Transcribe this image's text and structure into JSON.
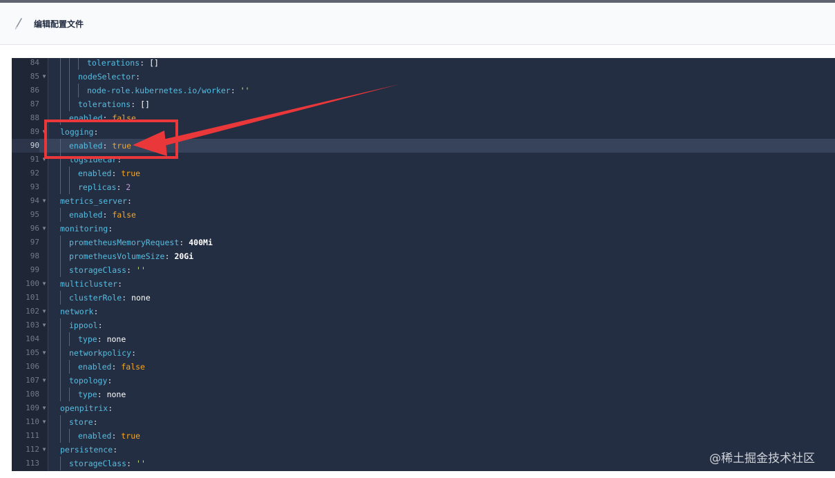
{
  "header": {
    "title": "编辑配置文件",
    "icon": "pencil-icon"
  },
  "colors": {
    "editor_background": "#242e42",
    "key": "#55bde2",
    "boolean": "#f5a623",
    "number": "#c397d8",
    "string": "#c8e17a",
    "highlight_box": "#e9373a"
  },
  "editor": {
    "active_line": 90,
    "lines": [
      {
        "num": 84,
        "fold": false,
        "indent": 3,
        "key": "tolerations",
        "value": "[]",
        "vtype": "plain"
      },
      {
        "num": 85,
        "fold": true,
        "indent": 2,
        "key": "nodeSelector",
        "value": "",
        "vtype": ""
      },
      {
        "num": 86,
        "fold": false,
        "indent": 3,
        "key": "node-role.kubernetes.io/worker",
        "value": "''",
        "vtype": "string"
      },
      {
        "num": 87,
        "fold": false,
        "indent": 2,
        "key": "tolerations",
        "value": "[]",
        "vtype": "plain"
      },
      {
        "num": 88,
        "fold": false,
        "indent": 1,
        "key": "enabled",
        "value": "false",
        "vtype": "bool"
      },
      {
        "num": 89,
        "fold": true,
        "indent": 0,
        "key": "logging",
        "value": "",
        "vtype": ""
      },
      {
        "num": 90,
        "fold": false,
        "indent": 1,
        "key": "enabled",
        "value": "true",
        "vtype": "bool"
      },
      {
        "num": 91,
        "fold": true,
        "indent": 1,
        "key": "logsidecar",
        "value": "",
        "vtype": ""
      },
      {
        "num": 92,
        "fold": false,
        "indent": 2,
        "key": "enabled",
        "value": "true",
        "vtype": "bool"
      },
      {
        "num": 93,
        "fold": false,
        "indent": 2,
        "key": "replicas",
        "value": "2",
        "vtype": "number"
      },
      {
        "num": 94,
        "fold": true,
        "indent": 0,
        "key": "metrics_server",
        "value": "",
        "vtype": ""
      },
      {
        "num": 95,
        "fold": false,
        "indent": 1,
        "key": "enabled",
        "value": "false",
        "vtype": "bool"
      },
      {
        "num": 96,
        "fold": true,
        "indent": 0,
        "key": "monitoring",
        "value": "",
        "vtype": ""
      },
      {
        "num": 97,
        "fold": false,
        "indent": 1,
        "key": "prometheusMemoryRequest",
        "value": "400Mi",
        "vtype": "bold"
      },
      {
        "num": 98,
        "fold": false,
        "indent": 1,
        "key": "prometheusVolumeSize",
        "value": "20Gi",
        "vtype": "bold"
      },
      {
        "num": 99,
        "fold": false,
        "indent": 1,
        "key": "storageClass",
        "value": "''",
        "vtype": "string"
      },
      {
        "num": 100,
        "fold": true,
        "indent": 0,
        "key": "multicluster",
        "value": "",
        "vtype": ""
      },
      {
        "num": 101,
        "fold": false,
        "indent": 1,
        "key": "clusterRole",
        "value": "none",
        "vtype": "plain"
      },
      {
        "num": 102,
        "fold": true,
        "indent": 0,
        "key": "network",
        "value": "",
        "vtype": ""
      },
      {
        "num": 103,
        "fold": true,
        "indent": 1,
        "key": "ippool",
        "value": "",
        "vtype": ""
      },
      {
        "num": 104,
        "fold": false,
        "indent": 2,
        "key": "type",
        "value": "none",
        "vtype": "plain"
      },
      {
        "num": 105,
        "fold": true,
        "indent": 1,
        "key": "networkpolicy",
        "value": "",
        "vtype": ""
      },
      {
        "num": 106,
        "fold": false,
        "indent": 2,
        "key": "enabled",
        "value": "false",
        "vtype": "bool"
      },
      {
        "num": 107,
        "fold": true,
        "indent": 1,
        "key": "topology",
        "value": "",
        "vtype": ""
      },
      {
        "num": 108,
        "fold": false,
        "indent": 2,
        "key": "type",
        "value": "none",
        "vtype": "plain"
      },
      {
        "num": 109,
        "fold": true,
        "indent": 0,
        "key": "openpitrix",
        "value": "",
        "vtype": ""
      },
      {
        "num": 110,
        "fold": true,
        "indent": 1,
        "key": "store",
        "value": "",
        "vtype": ""
      },
      {
        "num": 111,
        "fold": false,
        "indent": 2,
        "key": "enabled",
        "value": "true",
        "vtype": "bool"
      },
      {
        "num": 112,
        "fold": true,
        "indent": 0,
        "key": "persistence",
        "value": "",
        "vtype": ""
      },
      {
        "num": 113,
        "fold": false,
        "indent": 1,
        "key": "storageClass",
        "value": "''",
        "vtype": "string"
      }
    ]
  },
  "watermark": "@稀土掘金技术社区"
}
